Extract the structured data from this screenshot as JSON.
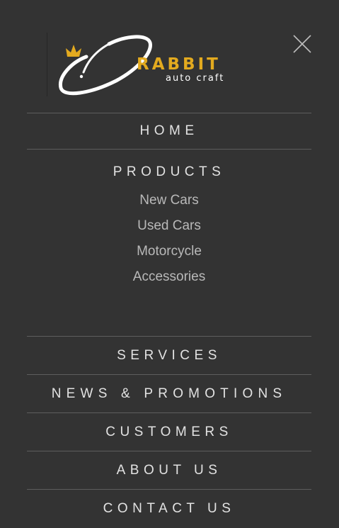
{
  "brand": {
    "name": "RABBIT",
    "tagline": "auto craft",
    "accent_color": "#e3aa1f",
    "logo_icon": "crowned-c-swoosh-logo"
  },
  "close_icon": "close-icon",
  "menu": {
    "items": [
      {
        "label": "HOME"
      },
      {
        "label": "PRODUCTS",
        "submenu": [
          {
            "label": "New Cars"
          },
          {
            "label": "Used Cars"
          },
          {
            "label": "Motorcycle"
          },
          {
            "label": "Accessories"
          }
        ]
      },
      {
        "label": "SERVICES"
      },
      {
        "label": "NEWS & PROMOTIONS"
      },
      {
        "label": "CUSTOMERS"
      },
      {
        "label": "ABOUT US"
      },
      {
        "label": "CONTACT US"
      }
    ]
  },
  "colors": {
    "background": "#333333",
    "divider": "#5e5e5e",
    "menu_text": "#e2e2e2",
    "submenu_text": "#b9b9b9"
  }
}
